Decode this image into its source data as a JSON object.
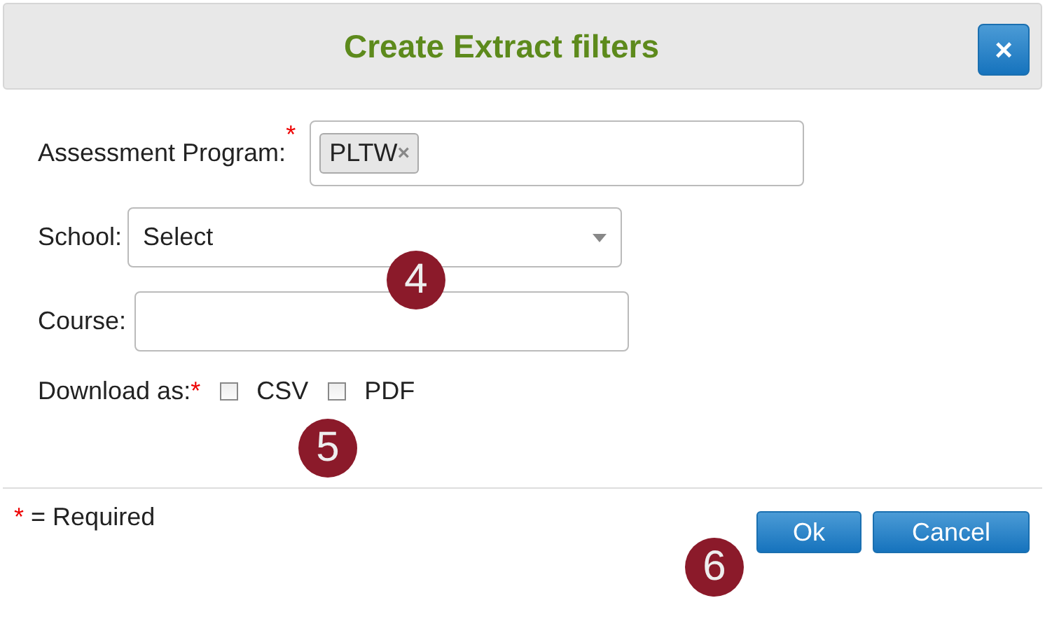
{
  "dialog": {
    "title": "Create Extract filters",
    "close": "×"
  },
  "fields": [
    {
      "kind": "tags",
      "label": "Assessment Program:",
      "required_mark": "*",
      "tags": [
        {
          "text": "PLTW",
          "remove": "×"
        }
      ]
    },
    {
      "kind": "select",
      "label": "School:",
      "value": "Select"
    },
    {
      "kind": "text",
      "label": "Course:"
    },
    {
      "kind": "checks",
      "label": "Download as:",
      "required_mark": "*",
      "options": [
        {
          "label": "CSV",
          "checked": false
        },
        {
          "label": "PDF",
          "checked": false
        }
      ]
    }
  ],
  "footer": {
    "mark": "*",
    "text": "= Required",
    "buttons": [
      "Ok",
      "Cancel"
    ]
  },
  "callouts": [
    "4",
    "5",
    "6"
  ]
}
